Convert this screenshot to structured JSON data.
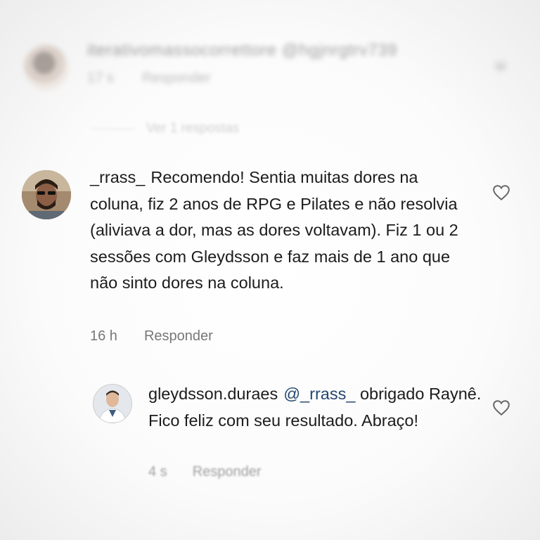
{
  "comment_blurred": {
    "username": "iterativomassocorrettore @hgjnrgtrv739",
    "time": "17 s",
    "reply_label": "Responder",
    "view_replies": "Ver 1 respostas"
  },
  "comment_main": {
    "username": "_rrass_",
    "text": "Recomendo! Sentia muitas dores na coluna, fiz 2 anos de RPG e Pilates e não resolvia (aliviava a dor, mas as dores voltavam). Fiz 1 ou 2 sessões com Gleydsson e faz mais de 1 ano que não sinto dores na coluna.",
    "time": "16 h",
    "reply_label": "Responder"
  },
  "comment_reply": {
    "username": "gleydsson.duraes",
    "mention": "@_rrass_",
    "text": "obrigado Raynê. Fico feliz com seu resultado. Abraço!",
    "time": "4 s",
    "reply_label": "Responder"
  },
  "icons": {
    "like": "heart-outline-icon",
    "more": "chevron-down-icon"
  },
  "colors": {
    "mention": "#25486e",
    "meta": "#777777",
    "text": "#1c1c1c"
  }
}
